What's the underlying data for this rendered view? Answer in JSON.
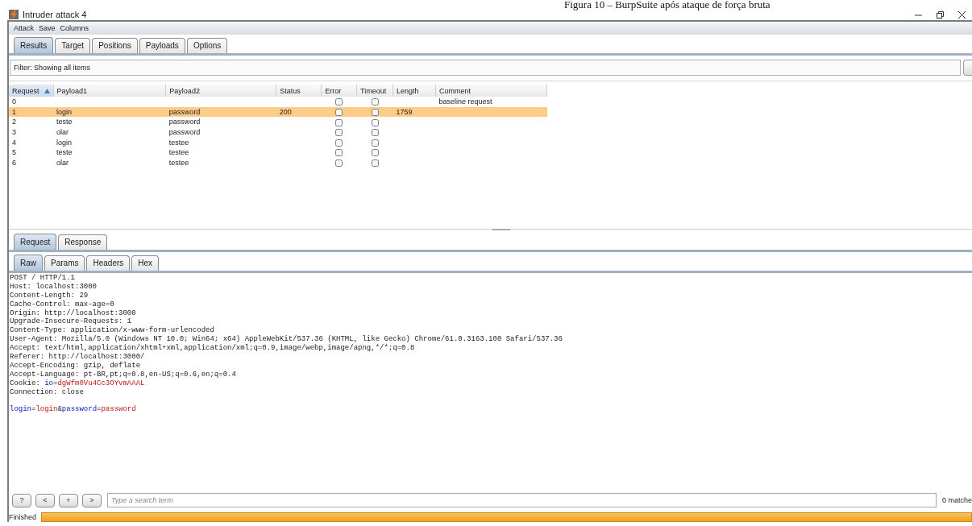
{
  "caption": "Figura 10 – BurpSuite após ataque de força bruta",
  "window": {
    "title": "Intruder attack 4"
  },
  "menu": [
    "Attack",
    "Save",
    "Columns"
  ],
  "tabs": [
    {
      "label": "Results",
      "selected": true
    },
    {
      "label": "Target",
      "selected": false
    },
    {
      "label": "Positions",
      "selected": false
    },
    {
      "label": "Payloads",
      "selected": false
    },
    {
      "label": "Options",
      "selected": false
    }
  ],
  "filter": "Filter: Showing all items",
  "table": {
    "columns": [
      "Request",
      "Payload1",
      "Payload2",
      "Status",
      "Error",
      "Timeout",
      "Length",
      "Comment"
    ],
    "rows": [
      {
        "request": "0",
        "payload1": "",
        "payload2": "",
        "status": "",
        "error": false,
        "timeout": false,
        "length": "",
        "comment": "baseline request",
        "selected": false
      },
      {
        "request": "1",
        "payload1": "login",
        "payload2": "password",
        "status": "200",
        "error": false,
        "timeout": false,
        "length": "1759",
        "comment": "",
        "selected": true
      },
      {
        "request": "2",
        "payload1": "teste",
        "payload2": "password",
        "status": "",
        "error": false,
        "timeout": false,
        "length": "",
        "comment": "",
        "selected": false
      },
      {
        "request": "3",
        "payload1": "olar",
        "payload2": "password",
        "status": "",
        "error": false,
        "timeout": false,
        "length": "",
        "comment": "",
        "selected": false
      },
      {
        "request": "4",
        "payload1": "login",
        "payload2": "testee",
        "status": "",
        "error": false,
        "timeout": false,
        "length": "",
        "comment": "",
        "selected": false
      },
      {
        "request": "5",
        "payload1": "teste",
        "payload2": "testee",
        "status": "",
        "error": false,
        "timeout": false,
        "length": "",
        "comment": "",
        "selected": false
      },
      {
        "request": "6",
        "payload1": "olar",
        "payload2": "testee",
        "status": "",
        "error": false,
        "timeout": false,
        "length": "",
        "comment": "",
        "selected": false
      }
    ]
  },
  "message_tabs": [
    {
      "label": "Request",
      "selected": true
    },
    {
      "label": "Response",
      "selected": false
    }
  ],
  "view_tabs": [
    {
      "label": "Raw",
      "selected": true
    },
    {
      "label": "Params",
      "selected": false
    },
    {
      "label": "Headers",
      "selected": false
    },
    {
      "label": "Hex",
      "selected": false
    }
  ],
  "request_lines": [
    [
      {
        "kind": "plain",
        "text": "POST / HTTP/1.1"
      }
    ],
    [
      {
        "kind": "plain",
        "text": "Host: localhost:3000"
      }
    ],
    [
      {
        "kind": "plain",
        "text": "Content-Length: 29"
      }
    ],
    [
      {
        "kind": "plain",
        "text": "Cache-Control: max-age=0"
      }
    ],
    [
      {
        "kind": "plain",
        "text": "Origin: http://localhost:3000"
      }
    ],
    [
      {
        "kind": "plain",
        "text": "Upgrade-Insecure-Requests: 1"
      }
    ],
    [
      {
        "kind": "plain",
        "text": "Content-Type: application/x-www-form-urlencoded"
      }
    ],
    [
      {
        "kind": "plain",
        "text": "User-Agent: Mozilla/5.0 (Windows NT 10.0; Win64; x64) AppleWebKit/537.36 (KHTML, like Gecko) Chrome/61.0.3163.100 Safari/537.36"
      }
    ],
    [
      {
        "kind": "plain",
        "text": "Accept: text/html,application/xhtml+xml,application/xml;q=0.9,image/webp,image/apng,*/*;q=0.8"
      }
    ],
    [
      {
        "kind": "plain",
        "text": "Referer: http://localhost:3000/"
      }
    ],
    [
      {
        "kind": "plain",
        "text": "Accept-Encoding: gzip, deflate"
      }
    ],
    [
      {
        "kind": "plain",
        "text": "Accept-Language: pt-BR,pt;q=0.8,en-US;q=0.6,en;q=0.4"
      }
    ],
    [
      {
        "kind": "plain",
        "text": "Cookie: "
      },
      {
        "kind": "name",
        "text": "io"
      },
      {
        "kind": "plain",
        "text": "="
      },
      {
        "kind": "value",
        "text": "dgWfm0Vu4Cc3OYvmAAAL"
      }
    ],
    [
      {
        "kind": "plain",
        "text": "Connection: close"
      }
    ]
  ],
  "request_body": [
    [
      {
        "kind": "name",
        "text": "login"
      },
      {
        "kind": "plain",
        "text": "="
      },
      {
        "kind": "value",
        "text": "login"
      },
      {
        "kind": "plain",
        "text": "&"
      },
      {
        "kind": "name",
        "text": "password"
      },
      {
        "kind": "plain",
        "text": "="
      },
      {
        "kind": "value",
        "text": "password"
      }
    ]
  ],
  "search": {
    "buttons": [
      "?",
      "<",
      "+",
      ">"
    ],
    "placeholder": "Type a search term",
    "matches": "0 matche"
  },
  "status": {
    "text": "Finished",
    "level": 1
  }
}
